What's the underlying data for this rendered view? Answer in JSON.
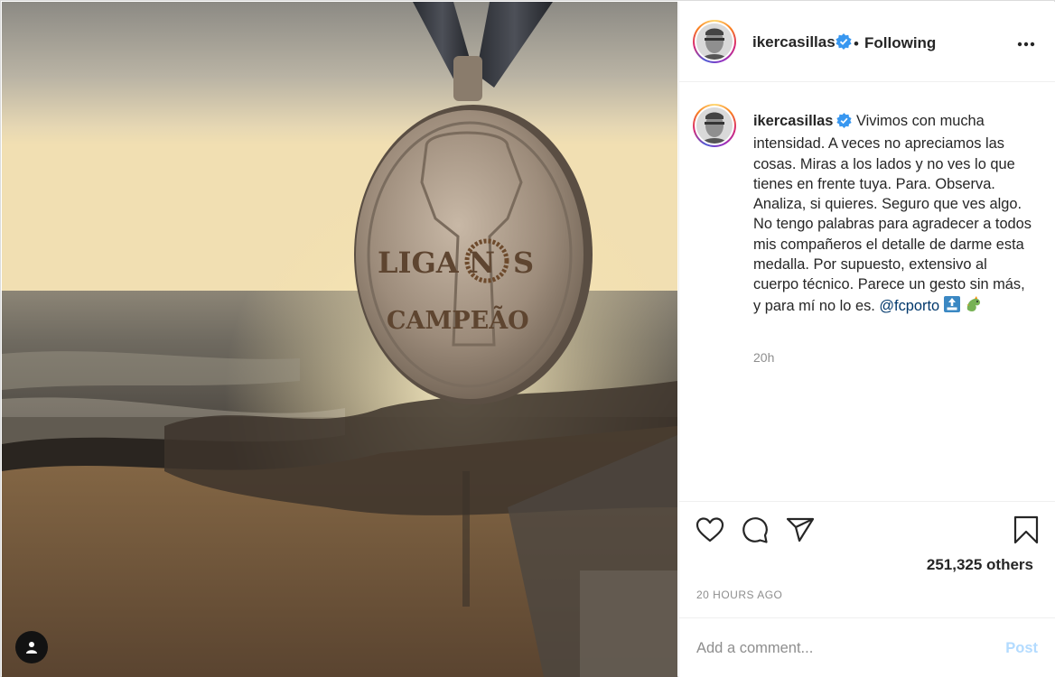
{
  "post": {
    "username": "ikercasillas",
    "follow_separator": "•",
    "follow_status": "Following",
    "more_icon": "more-options-icon",
    "caption_text": "Vivimos con mucha intensidad. A veces no apreciamos las cosas. Miras a los lados y no ves lo que tienes en frente tuya. Para. Observa. Analiza, si quieres. Seguro que ves algo. No tengo palabras para agradecer a todos mis compañeros el detalle de darme esta medalla. Por supuesto, extensivo al cuerpo técnico. Parece un gesto sin más, y para mí no lo es. ",
    "mention": "@fcporto",
    "emojis": [
      "top-arrow-emoji",
      "dragon-emoji"
    ],
    "time_ago": "20h",
    "likes": "251,325 others",
    "date": "20 HOURS AGO"
  },
  "photo": {
    "medal_line1": "LIGA N",
    "medal_line1_end": "S",
    "medal_line2": "CAMPEÃO"
  },
  "comment": {
    "placeholder": "Add a comment...",
    "post_label": "Post"
  },
  "colors": {
    "verified": "#3897f0",
    "mention": "#00376b",
    "post_disabled": "#b3dbff",
    "muted": "#8e8e8e"
  }
}
